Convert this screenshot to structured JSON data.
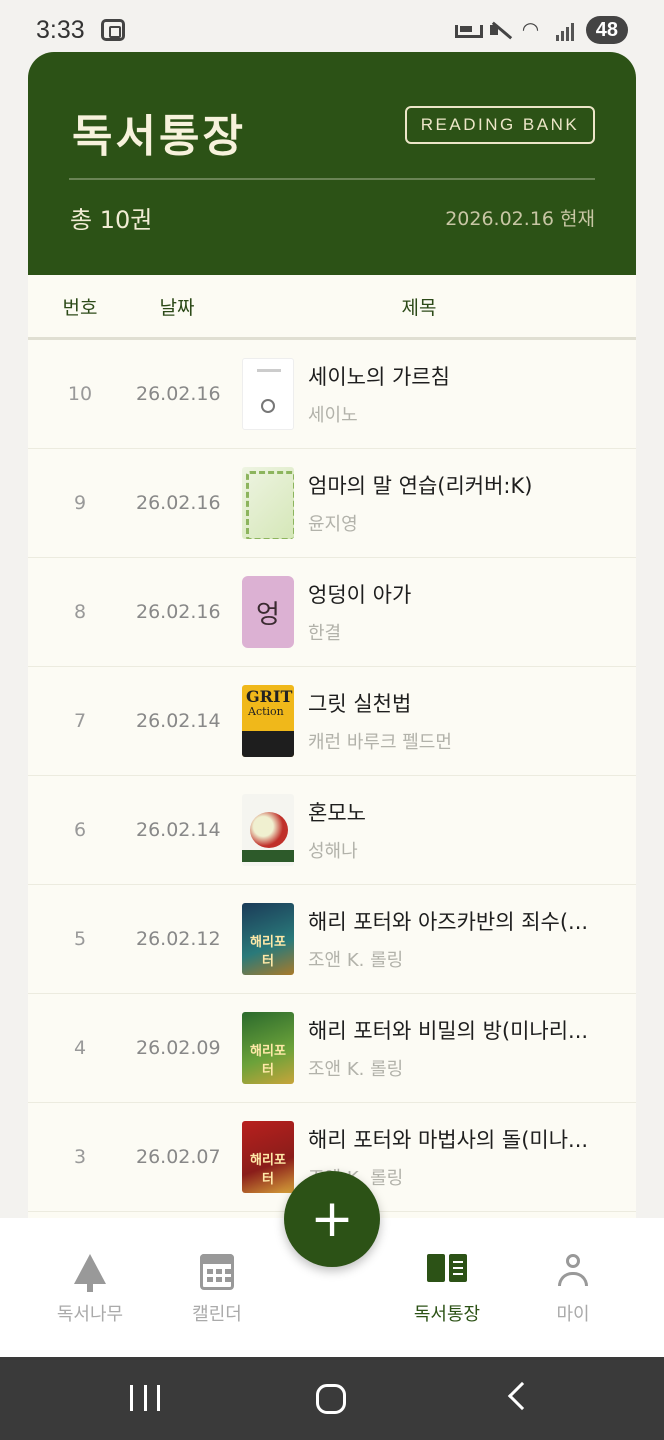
{
  "status_bar": {
    "time": "3:33",
    "battery": "48"
  },
  "header": {
    "title": "독서통장",
    "badge": "READING BANK",
    "total": "총 10권",
    "as_of": "2026.02.16 현재"
  },
  "table": {
    "headers": {
      "num": "번호",
      "date": "날짜",
      "title": "제목"
    },
    "rows": [
      {
        "num": "10",
        "date": "26.02.16",
        "title": "세이노의 가르침",
        "author": "세이노",
        "cover_text": ""
      },
      {
        "num": "9",
        "date": "26.02.16",
        "title": "엄마의 말 연습(리커버:K)",
        "author": "윤지영",
        "cover_text": ""
      },
      {
        "num": "8",
        "date": "26.02.16",
        "title": "엉덩이 아가",
        "author": "한결",
        "cover_text": "엉"
      },
      {
        "num": "7",
        "date": "26.02.14",
        "title": "그릿 실천법",
        "author": "캐런 바루크 펠드먼",
        "cover_text": "GRIT"
      },
      {
        "num": "6",
        "date": "26.02.14",
        "title": "혼모노",
        "author": "성해나",
        "cover_text": ""
      },
      {
        "num": "5",
        "date": "26.02.12",
        "title": "해리 포터와 아즈카반의 죄수(...",
        "author": "조앤 K. 롤링",
        "cover_text": "해리포터"
      },
      {
        "num": "4",
        "date": "26.02.09",
        "title": "해리 포터와 비밀의 방(미나리...",
        "author": "조앤 K. 롤링",
        "cover_text": "해리포터"
      },
      {
        "num": "3",
        "date": "26.02.07",
        "title": "해리 포터와 마법사의 돌(미나...",
        "author": "조앤 K. 롤링",
        "cover_text": "해리포터"
      }
    ]
  },
  "fab": {
    "label": "+"
  },
  "bottom_nav": {
    "items": [
      {
        "label": "독서나무",
        "icon": "tree-icon"
      },
      {
        "label": "캘린더",
        "icon": "calendar-icon"
      },
      {
        "label": "독서통장",
        "icon": "book-icon",
        "active": true
      },
      {
        "label": "마이",
        "icon": "user-icon"
      }
    ]
  },
  "colors": {
    "primary": "#2c5216",
    "header_text": "#f7f2dc",
    "table_bg": "#fcfbf3"
  }
}
